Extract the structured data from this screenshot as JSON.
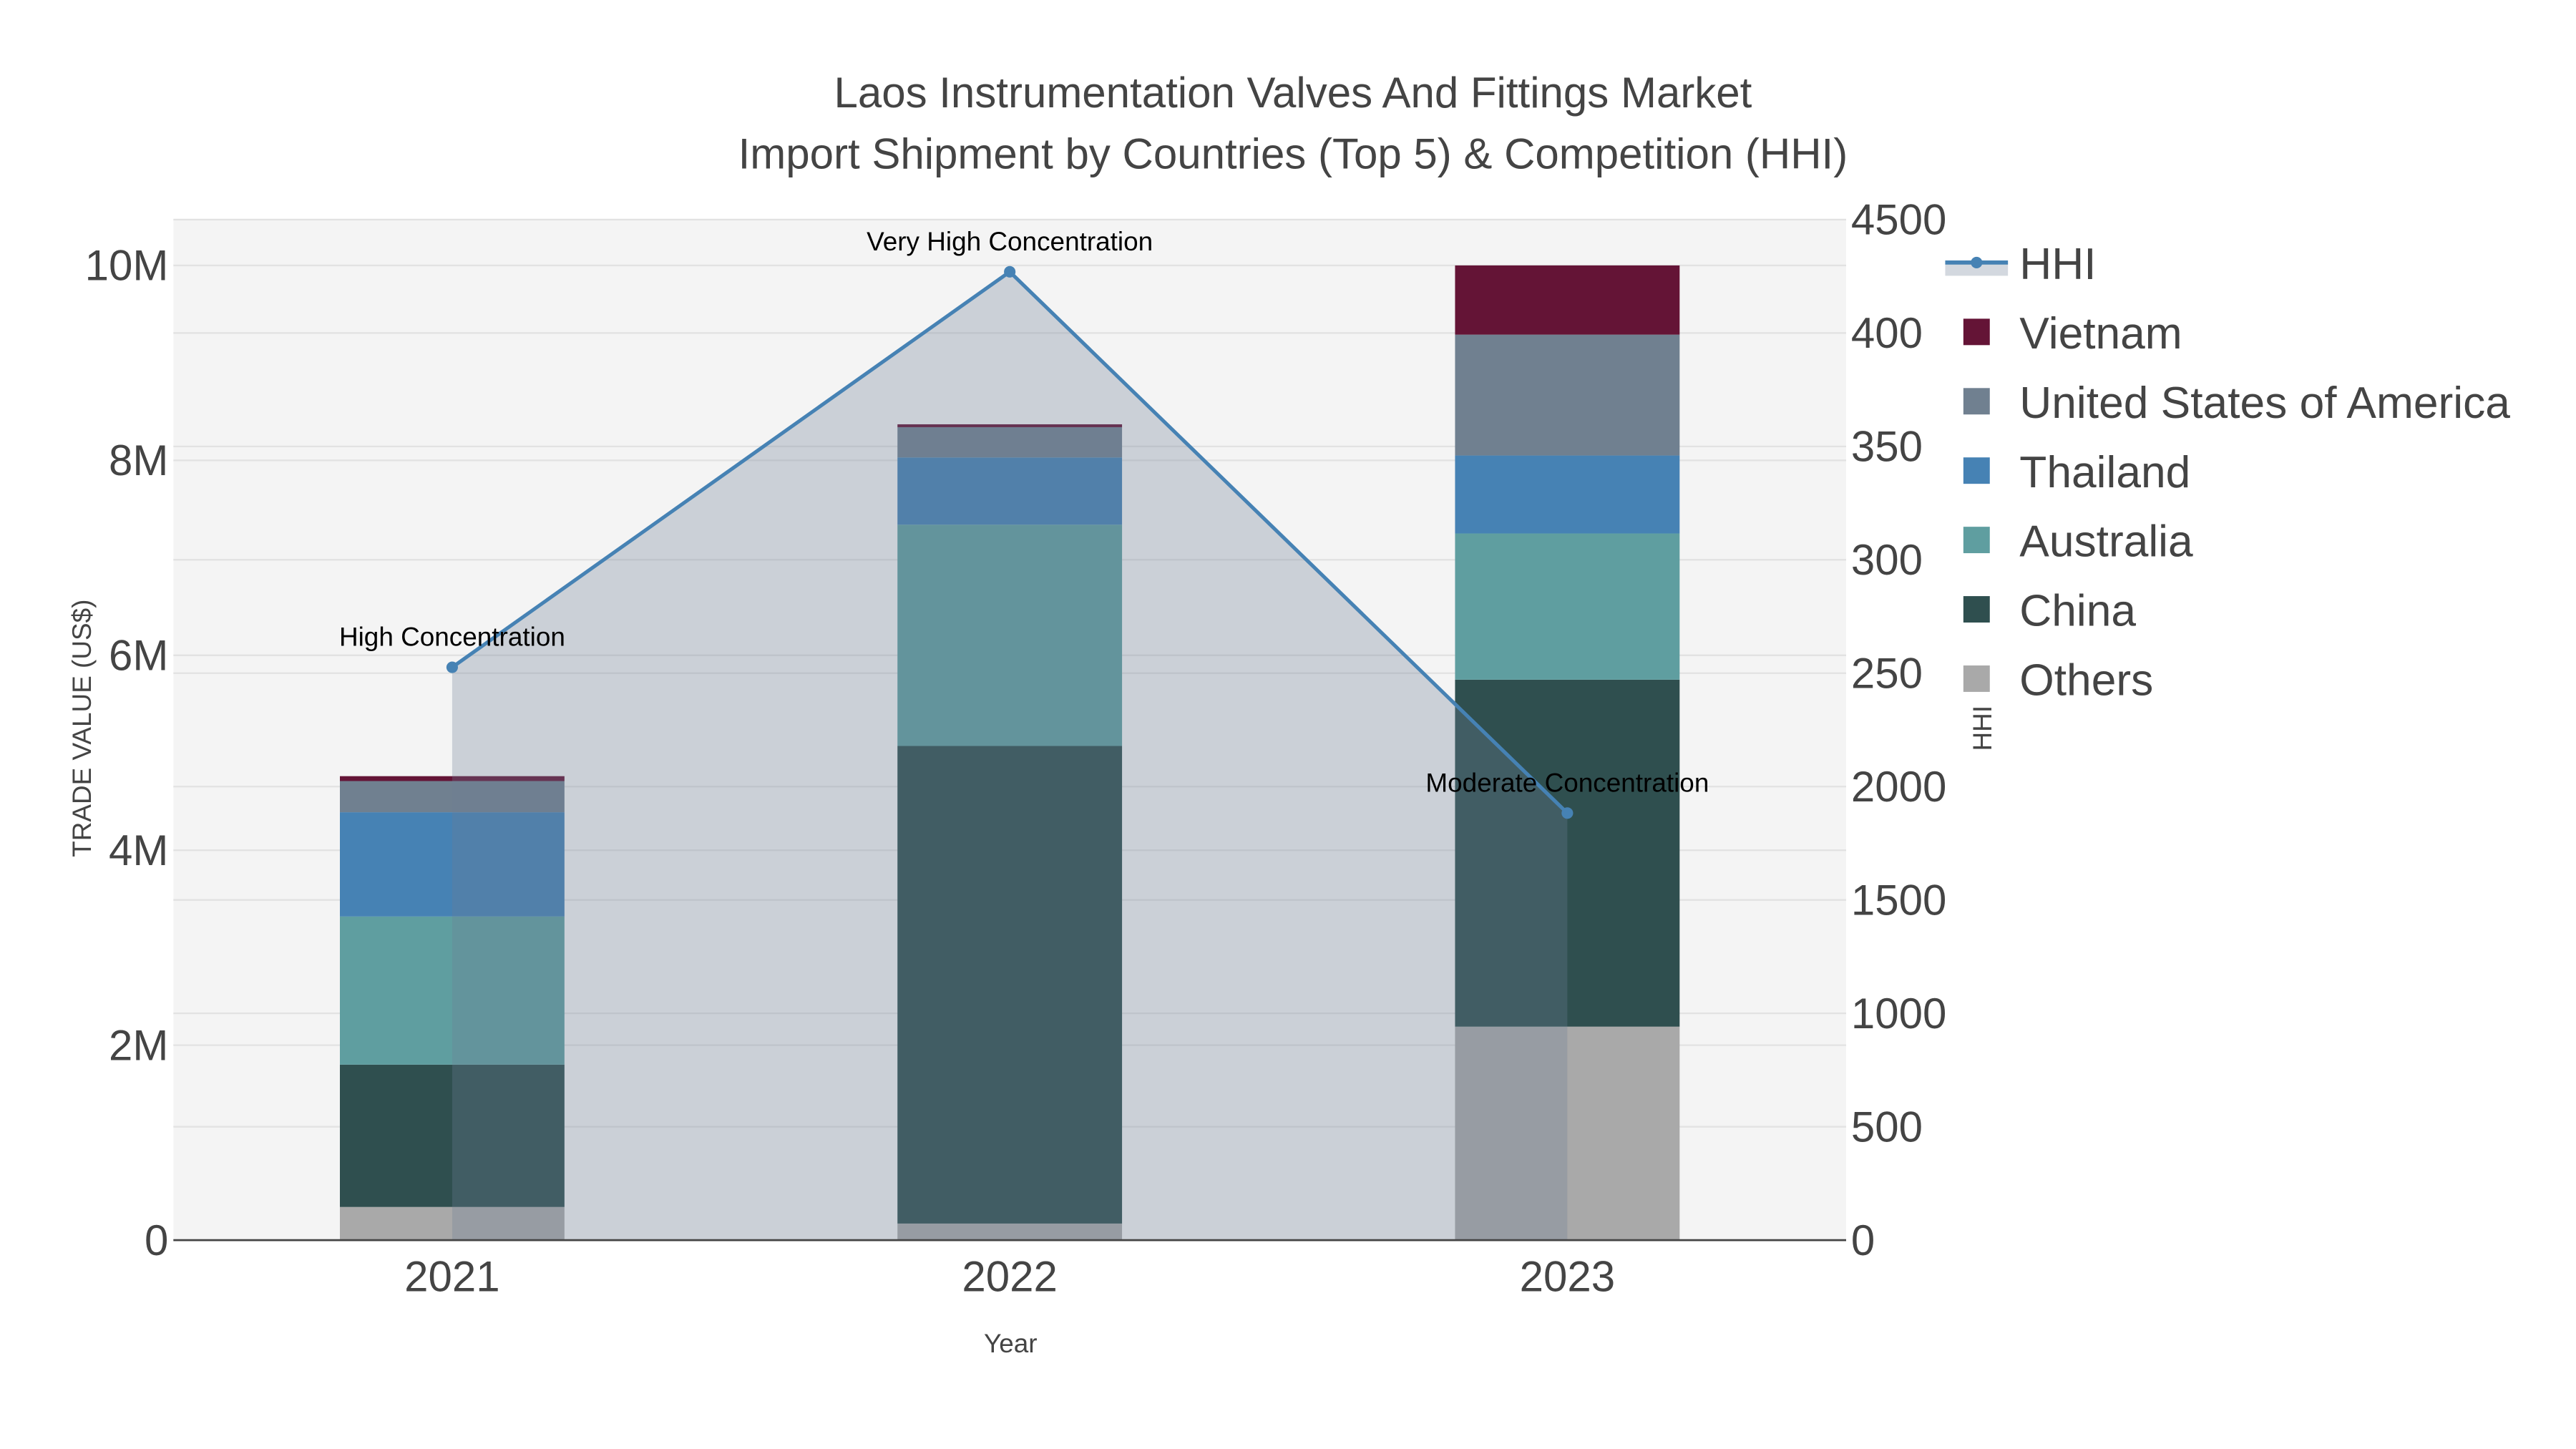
{
  "chart_data": {
    "type": "bar",
    "title_line1": "Laos Instrumentation Valves And Fittings Market",
    "title_line2": "Import Shipment by Countries (Top 5) & Competition (HHI)",
    "xlabel": "Year",
    "ylabel": "TRADE VALUE (US$)",
    "y2label": "HHI",
    "categories": [
      "2021",
      "2022",
      "2023"
    ],
    "ylim": [
      0,
      10470000
    ],
    "y2lim": [
      0,
      4500
    ],
    "yticks": [
      {
        "v": 0,
        "label": "0"
      },
      {
        "v": 2000000,
        "label": "2M"
      },
      {
        "v": 4000000,
        "label": "4M"
      },
      {
        "v": 6000000,
        "label": "6M"
      },
      {
        "v": 8000000,
        "label": "8M"
      },
      {
        "v": 10000000,
        "label": "10M"
      }
    ],
    "y2ticks": [
      {
        "v": 0,
        "label": "0"
      },
      {
        "v": 500,
        "label": "500"
      },
      {
        "v": 1000,
        "label": "1000"
      },
      {
        "v": 1500,
        "label": "1500"
      },
      {
        "v": 2000,
        "label": "2000"
      },
      {
        "v": 2500,
        "label": "250"
      },
      {
        "v": 3000,
        "label": "300"
      },
      {
        "v": 3500,
        "label": "350"
      },
      {
        "v": 4000,
        "label": "400"
      },
      {
        "v": 4500,
        "label": "4500"
      }
    ],
    "grid": true,
    "legend_placement": "right",
    "series": [
      {
        "name": "Others",
        "color": "#a9a9a9",
        "values": [
          340000,
          170000,
          2190000
        ]
      },
      {
        "name": "China",
        "color": "#2f4f4f",
        "values": [
          1460000,
          4900000,
          3560000
        ]
      },
      {
        "name": "Australia",
        "color": "#5f9ea0",
        "values": [
          1520000,
          2270000,
          1500000
        ]
      },
      {
        "name": "Thailand",
        "color": "#4682b4",
        "values": [
          1070000,
          690000,
          800000
        ]
      },
      {
        "name": "United States of America",
        "color": "#708090",
        "values": [
          320000,
          310000,
          1240000
        ]
      },
      {
        "name": "Vietnam",
        "color": "#641436",
        "values": [
          50000,
          30000,
          710000
        ]
      }
    ],
    "hhi": {
      "name": "HHI",
      "color": "#4682b4",
      "values": [
        2526,
        4270,
        1883
      ],
      "annotations": [
        "High Concentration",
        "Very High Concentration",
        "Moderate Concentration"
      ]
    }
  }
}
